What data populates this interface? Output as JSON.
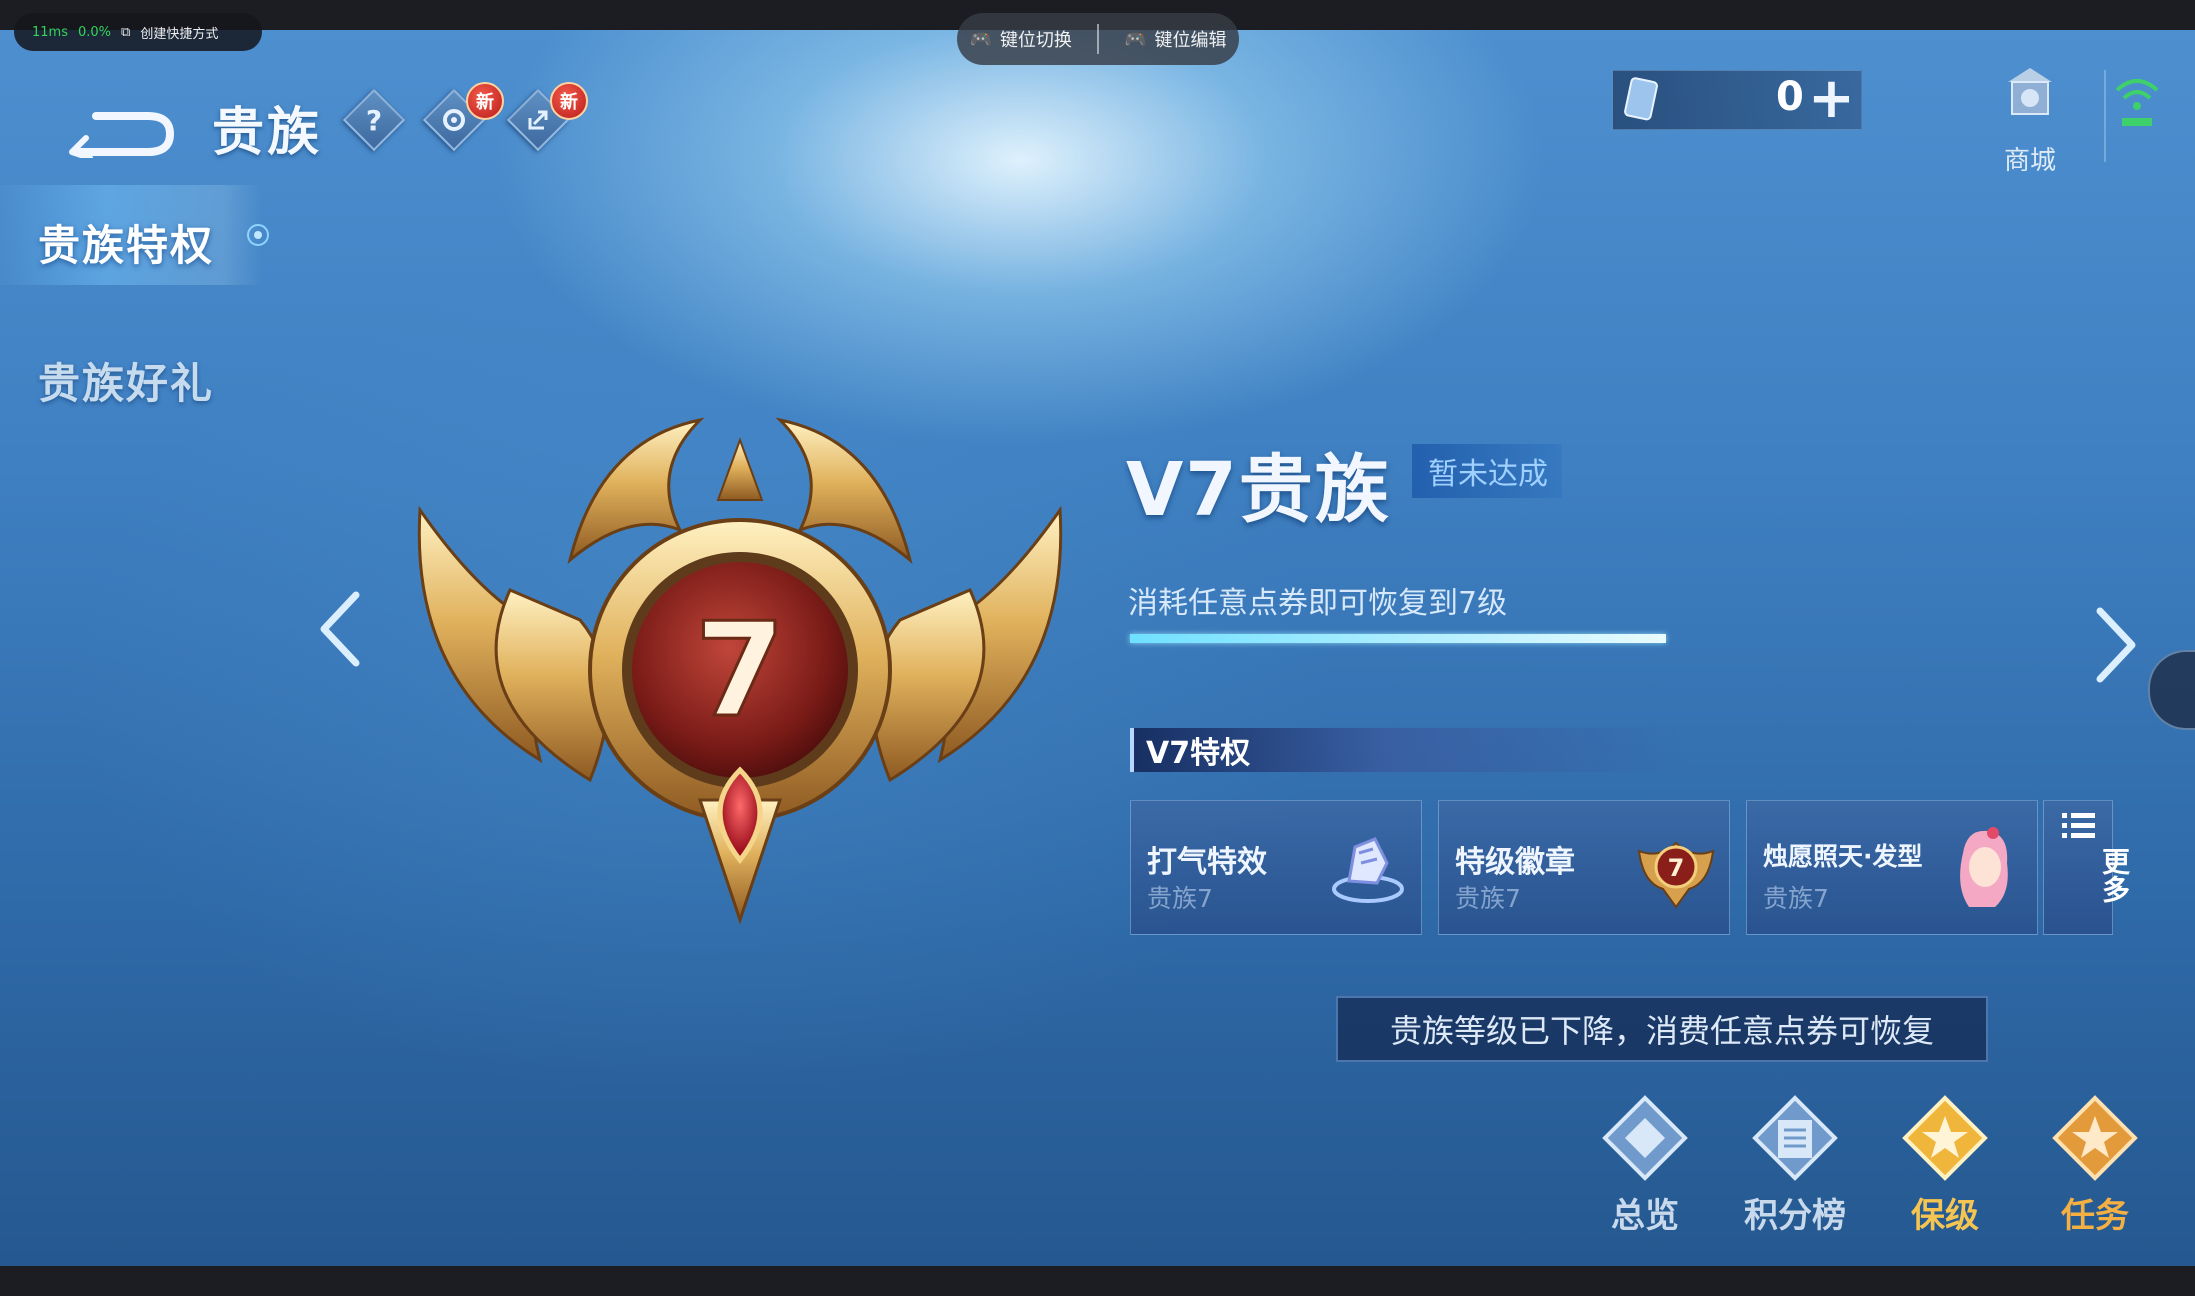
{
  "overlay": {
    "ping": "11ms",
    "loss": "0.0%",
    "shortcut_label": "创建快捷方式",
    "key_switch_label": "键位切换",
    "key_edit_label": "键位编辑"
  },
  "header": {
    "title": "贵族",
    "help_icon": "?",
    "settings_badge": "新",
    "share_badge": "新",
    "currency_value": "0",
    "currency_plus": "+",
    "shop_label": "商城"
  },
  "sidebar": {
    "items": [
      {
        "label": "贵族特权",
        "active": true
      },
      {
        "label": "贵族好礼",
        "active": false
      }
    ]
  },
  "level": {
    "emblem_number": "7",
    "title": "V7贵族",
    "status": "暂未达成",
    "restore_text": "消耗任意点券即可恢复到7级",
    "progress": 1.0
  },
  "privileges": {
    "heading": "V7特权",
    "cards": [
      {
        "name": "打气特效",
        "sub": "贵族7",
        "icon": "cheer-effect-icon"
      },
      {
        "name": "特级徽章",
        "sub": "贵族7",
        "icon": "badge-icon"
      },
      {
        "name": "烛愿照天·发型",
        "sub": "贵族7",
        "icon": "hairstyle-icon"
      }
    ],
    "more_label": "更多"
  },
  "notice": "贵族等级已下降，消费任意点券可恢复",
  "bottom_nav": [
    {
      "label": "总览",
      "color": "#c9d9ec"
    },
    {
      "label": "积分榜",
      "color": "#c9d9ec"
    },
    {
      "label": "保级",
      "color": "#f5c451"
    },
    {
      "label": "任务",
      "color": "#f5b044"
    }
  ],
  "colors": {
    "accent_gold": "#d9a84a",
    "badge_red": "#b81d1a",
    "progress": "#6fe0ff"
  }
}
